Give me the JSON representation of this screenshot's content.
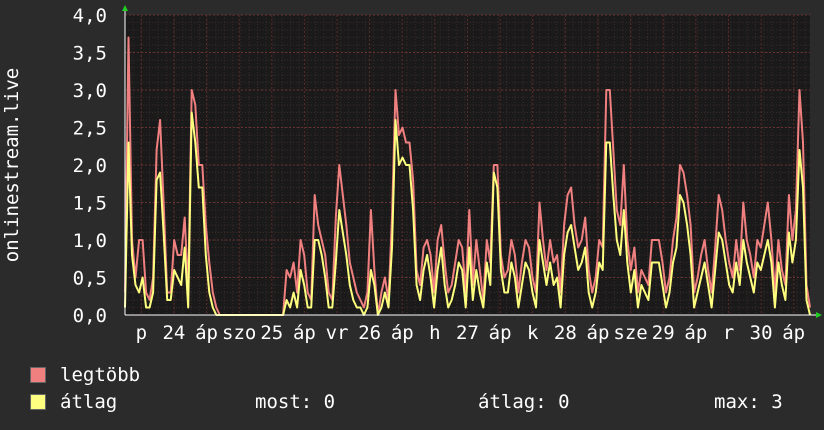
{
  "chart_data": {
    "type": "line",
    "ylabel": "onlinestream.live",
    "ylim": [
      0,
      4
    ],
    "yticks": [
      "0,0",
      "0,5",
      "1,0",
      "1,5",
      "2,0",
      "2,5",
      "3,0",
      "3,5",
      "4,0"
    ],
    "xlabels": [
      "p",
      "24",
      "áp",
      "szo",
      "25",
      "áp",
      "vr",
      "26",
      "áp",
      "h",
      "27",
      "áp",
      "k",
      "28",
      "áp",
      "sze",
      "29",
      "áp",
      "r",
      "30",
      "áp"
    ],
    "grid": true,
    "series": [
      {
        "name": "legtöbb",
        "color": "#f08080",
        "values": [
          0.3,
          3.7,
          1,
          0.5,
          1,
          1,
          0.3,
          0.2,
          0.5,
          2.2,
          2.6,
          1.5,
          0.3,
          0.3,
          1,
          0.8,
          0.8,
          1.3,
          0.3,
          3,
          2.8,
          2,
          2,
          1.2,
          0.7,
          0.3,
          0.1,
          0,
          0,
          0,
          0,
          0,
          0,
          0,
          0,
          0,
          0,
          0,
          0,
          0,
          0,
          0,
          0,
          0,
          0,
          0,
          0.6,
          0.5,
          0.7,
          0.3,
          1,
          0.8,
          0.3,
          0.2,
          1.6,
          1.2,
          1,
          0.8,
          0.3,
          0.2,
          1.3,
          2,
          1.6,
          1.2,
          0.7,
          0.5,
          0.3,
          0.2,
          0.1,
          0.3,
          1.4,
          0.6,
          0,
          0.3,
          0.5,
          0.2,
          1.3,
          3,
          2.4,
          2.5,
          2.3,
          2.3,
          1.8,
          0.6,
          0.4,
          0.9,
          1,
          0.8,
          0.3,
          1,
          1.2,
          0.7,
          0.3,
          0.4,
          0.7,
          1,
          0.9,
          0.3,
          1.4,
          0.4,
          1,
          0.6,
          0.2,
          1,
          0.7,
          2,
          2,
          0.8,
          0.5,
          0.6,
          1,
          0.8,
          0.3,
          0.7,
          1,
          0.9,
          0.5,
          0.3,
          1.5,
          1,
          0.6,
          1,
          0.7,
          0.8,
          0.3,
          1.2,
          1.6,
          1.7,
          1.2,
          0.9,
          1,
          1.3,
          0.6,
          0.3,
          0.5,
          1,
          0.9,
          3,
          3,
          2.2,
          1.4,
          1.2,
          2,
          1,
          0.6,
          0.9,
          0.3,
          0.6,
          0.5,
          0.4,
          1,
          1,
          1,
          0.7,
          0.3,
          0.5,
          1,
          1.3,
          2,
          1.9,
          1.6,
          1.2,
          0.3,
          0.5,
          0.8,
          1,
          0.6,
          0.3,
          0.9,
          1.6,
          1.4,
          1,
          0.7,
          0.5,
          1,
          0.6,
          1.5,
          1,
          0.8,
          0.5,
          1,
          0.9,
          1.2,
          1.5,
          1,
          0.3,
          1,
          0.6,
          0.4,
          1.6,
          1,
          1.4,
          3,
          2.3,
          0.4,
          0.1
        ]
      },
      {
        "name": "átlag",
        "color": "#ffff80",
        "values": [
          0.1,
          2.3,
          0.8,
          0.4,
          0.3,
          0.5,
          0.1,
          0.1,
          0.3,
          1.8,
          1.9,
          1.1,
          0.2,
          0.2,
          0.6,
          0.5,
          0.4,
          0.9,
          0.1,
          2.7,
          2.3,
          1.7,
          1.7,
          0.8,
          0.3,
          0.1,
          0,
          0,
          0,
          0,
          0,
          0,
          0,
          0,
          0,
          0,
          0,
          0,
          0,
          0,
          0,
          0,
          0,
          0,
          0,
          0,
          0.2,
          0.1,
          0.3,
          0.1,
          0.6,
          0.4,
          0.1,
          0.1,
          1,
          1,
          0.8,
          0.5,
          0.1,
          0.1,
          0.7,
          1.4,
          1.1,
          0.8,
          0.4,
          0.2,
          0.1,
          0.1,
          0,
          0.1,
          0.6,
          0.4,
          0,
          0.1,
          0.3,
          0.1,
          0.9,
          2.6,
          2,
          2.1,
          2,
          2,
          1.4,
          0.4,
          0.2,
          0.6,
          0.8,
          0.5,
          0.1,
          0.6,
          0.9,
          0.4,
          0.1,
          0.2,
          0.4,
          0.7,
          0.6,
          0.1,
          0.9,
          0.2,
          0.6,
          0.3,
          0.1,
          0.7,
          0.4,
          1.9,
          1.7,
          0.6,
          0.3,
          0.3,
          0.7,
          0.5,
          0.1,
          0.4,
          0.7,
          0.6,
          0.3,
          0.1,
          1,
          0.7,
          0.4,
          0.7,
          0.4,
          0.5,
          0.1,
          0.8,
          1.1,
          1.2,
          0.9,
          0.6,
          0.7,
          0.9,
          0.3,
          0.1,
          0.3,
          0.7,
          0.6,
          2.3,
          2.3,
          1.6,
          1,
          0.8,
          1.4,
          0.7,
          0.3,
          0.6,
          0.1,
          0.4,
          0.3,
          0.2,
          0.7,
          0.7,
          0.7,
          0.4,
          0.1,
          0.3,
          0.7,
          0.9,
          1.6,
          1.5,
          1.2,
          0.8,
          0.1,
          0.3,
          0.5,
          0.7,
          0.4,
          0.1,
          0.6,
          1.1,
          1,
          0.7,
          0.4,
          0.3,
          0.7,
          0.4,
          1,
          0.7,
          0.5,
          0.3,
          0.7,
          0.6,
          0.8,
          1,
          0.7,
          0.1,
          0.7,
          0.4,
          0.2,
          1.1,
          0.7,
          1,
          2.2,
          1.7,
          0.2,
          0
        ]
      }
    ]
  },
  "legend": [
    {
      "label": "legtöbb",
      "color": "#f08080"
    },
    {
      "label": "átlag",
      "color": "#ffff80"
    }
  ],
  "stats": {
    "most": "most: 0",
    "atlag": "átlag: 0",
    "max": "max: 3"
  }
}
